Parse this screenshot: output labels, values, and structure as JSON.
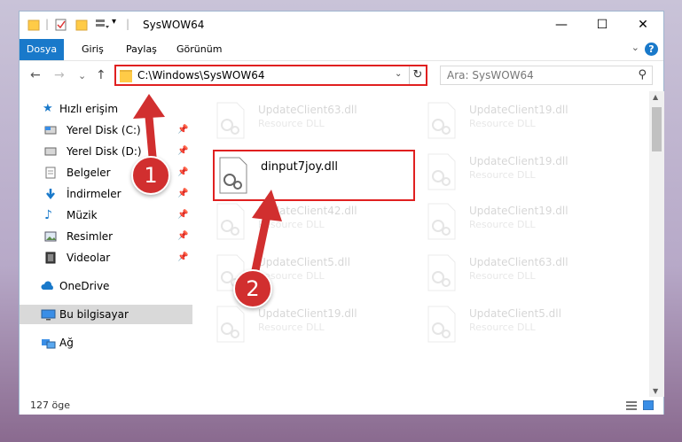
{
  "window": {
    "title": "SysWOW64",
    "minimize": "—",
    "maximize": "☐",
    "close": "✕"
  },
  "ribbon": {
    "file": "Dosya",
    "tabs": [
      "Giriş",
      "Paylaş",
      "Görünüm"
    ],
    "help": "?",
    "expand": "⌄"
  },
  "address": {
    "path": "C:\\Windows\\SysWOW64",
    "dropdown": "⌄",
    "refresh": "↻"
  },
  "nav_buttons": {
    "back": "←",
    "forward": "→",
    "recent": "⌄",
    "up": "↑"
  },
  "search": {
    "placeholder": "Ara: SysWOW64",
    "icon": "search-icon"
  },
  "navpane": {
    "items": [
      {
        "label": "Hızlı erişim",
        "icon": "star-icon",
        "pinned": false
      },
      {
        "label": "Yerel Disk (C:)",
        "icon": "drive-icon",
        "pinned": true
      },
      {
        "label": "Yerel Disk (D:)",
        "icon": "drive-icon",
        "pinned": true
      },
      {
        "label": "Belgeler",
        "icon": "document-icon",
        "pinned": true
      },
      {
        "label": "İndirmeler",
        "icon": "download-icon",
        "pinned": true
      },
      {
        "label": "Müzik",
        "icon": "music-icon",
        "pinned": true
      },
      {
        "label": "Resimler",
        "icon": "pictures-icon",
        "pinned": true
      },
      {
        "label": "Videolar",
        "icon": "video-icon",
        "pinned": true
      },
      {
        "label": "OneDrive",
        "icon": "cloud-icon",
        "pinned": false
      },
      {
        "label": "Bu bilgisayar",
        "icon": "computer-icon",
        "pinned": false,
        "selected": true
      },
      {
        "label": "Ağ",
        "icon": "network-icon",
        "pinned": false
      }
    ]
  },
  "files": {
    "left": [
      {
        "name": "UpdateClient63.dll",
        "type": "Resource DLL"
      },
      {
        "name": "dinput7joy.dll",
        "type": ""
      },
      {
        "name": "UpdateClient42.dll",
        "type": "Resource DLL"
      },
      {
        "name": "UpdateClient5.dll",
        "type": "Resource DLL"
      },
      {
        "name": "UpdateClient19.dll",
        "type": "Resource DLL"
      }
    ],
    "right": [
      {
        "name": "UpdateClient19.dll",
        "type": "Resource DLL"
      },
      {
        "name": "UpdateClient19.dll",
        "type": "Resource DLL"
      },
      {
        "name": "UpdateClient19.dll",
        "type": "Resource DLL"
      },
      {
        "name": "UpdateClient63.dll",
        "type": "Resource DLL"
      },
      {
        "name": "UpdateClient5.dll",
        "type": "Resource DLL"
      }
    ]
  },
  "status": {
    "count": "127 öge"
  },
  "callouts": {
    "one": "1",
    "two": "2"
  },
  "colors": {
    "accent": "#1979ca",
    "highlight": "#e02020",
    "badge": "#d12f2f"
  }
}
